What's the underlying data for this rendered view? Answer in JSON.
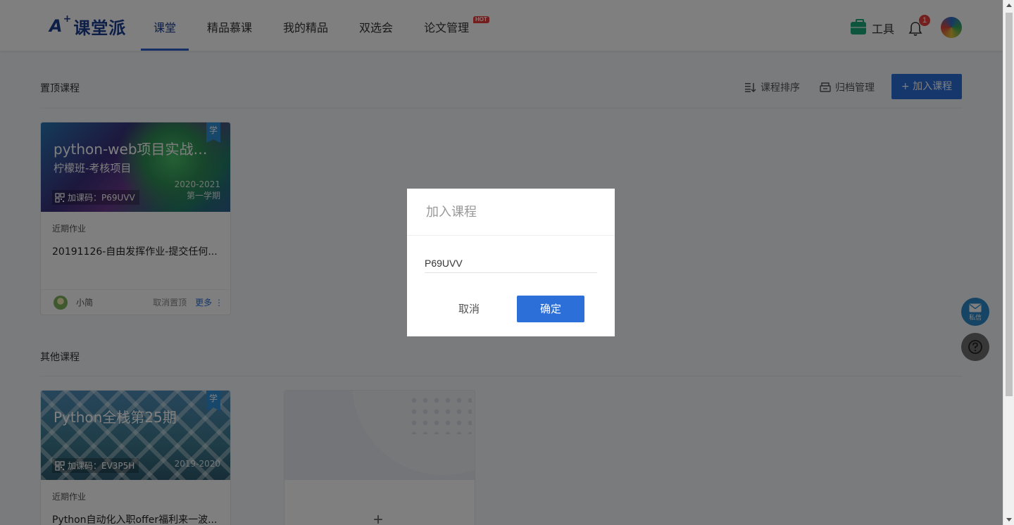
{
  "header": {
    "logo": "A+课堂派",
    "logo_a": "A",
    "logo_plus": "+",
    "logo_text": "课堂派",
    "nav": [
      {
        "label": "课堂",
        "active": true
      },
      {
        "label": "精品慕课"
      },
      {
        "label": "我的精品"
      },
      {
        "label": "双选会"
      },
      {
        "label": "论文管理"
      }
    ],
    "hot_badge": "HOT",
    "tools_label": "工具",
    "notification_count": "1"
  },
  "pinned": {
    "title": "置顶课程",
    "sort_label": "课程排序",
    "archive_label": "归档管理",
    "join_label": "+ 加入课程",
    "cards": [
      {
        "tag": "学",
        "title": "python-web项目实战…",
        "subtitle": "柠檬班-考核项目",
        "code": "加课码：P69UVV",
        "year": "2020-2021",
        "term": "第一学期",
        "hw_label": "近期作业",
        "hw_title": "20191126-自由发挥作业-提交任何...",
        "teacher": "小简",
        "unpin": "取消置顶",
        "more": "更多 ⋮"
      }
    ]
  },
  "others": {
    "title": "其他课程",
    "cards": [
      {
        "tag": "学",
        "title": "Python全栈第25期",
        "code": "加课码：EV3P5H",
        "year": "2019-2020",
        "hw_label": "近期作业",
        "hw_title": "Python自动化入职offer福利来一波..."
      }
    ],
    "add_symbol": "+"
  },
  "floating": {
    "mail_label": "私信",
    "help_icon": "question-icon"
  },
  "modal": {
    "title": "加入课程",
    "input_value": "P69UVV",
    "cancel_label": "取消",
    "confirm_label": "确定"
  }
}
